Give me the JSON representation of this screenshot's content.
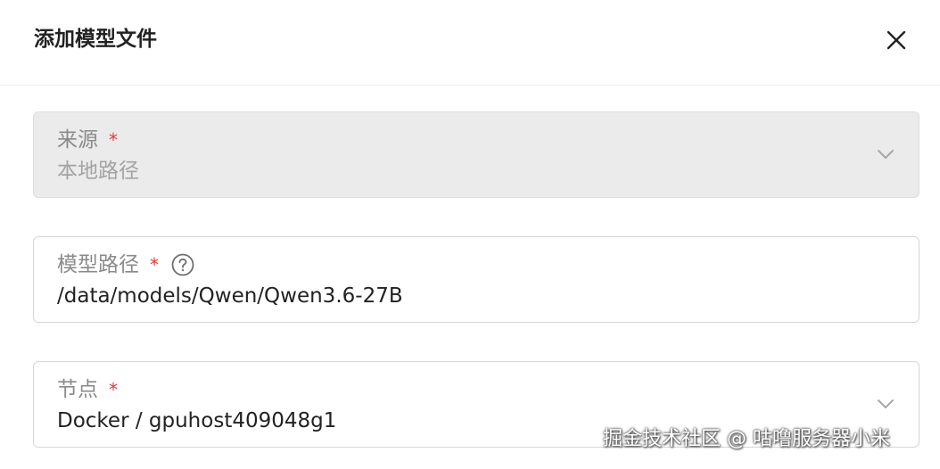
{
  "dialog": {
    "title": "添加模型文件",
    "close_icon": "close-icon"
  },
  "fields": {
    "source": {
      "label": "来源",
      "required_mark": "*",
      "value": "本地路径",
      "disabled": true,
      "icon": "chevron-down-icon"
    },
    "model_path": {
      "label": "模型路径",
      "required_mark": "*",
      "value": "/data/models/Qwen/Qwen3.6-27B",
      "help_icon": "question-circle-icon"
    },
    "node": {
      "label": "节点",
      "required_mark": "*",
      "value": "Docker / gpuhost409048g1",
      "icon": "chevron-down-icon"
    }
  },
  "watermark": "掘金技术社区 @ 咕噜服务器小米",
  "colors": {
    "required": "#e53935",
    "label": "#8a8a8a",
    "text": "#222222",
    "disabled_bg": "#ebebeb",
    "border": "#d6d6d6"
  }
}
